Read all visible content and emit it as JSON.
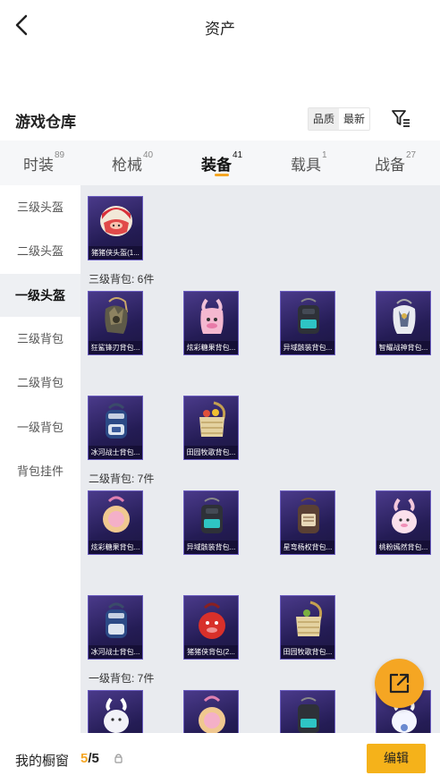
{
  "header": {
    "title": "资产"
  },
  "warehouse": {
    "title": "游戏仓库",
    "sort_quality": "品质",
    "sort_latest": "最新"
  },
  "tabs": [
    {
      "label": "时装",
      "count": "89"
    },
    {
      "label": "枪械",
      "count": "40"
    },
    {
      "label": "装备",
      "count": "41"
    },
    {
      "label": "载具",
      "count": "1"
    },
    {
      "label": "战备",
      "count": "27"
    }
  ],
  "active_tab": "装备",
  "sidebar": [
    {
      "label": "三级头盔"
    },
    {
      "label": "二级头盔"
    },
    {
      "label": "一级头盔"
    },
    {
      "label": "三级背包"
    },
    {
      "label": "二级背包"
    },
    {
      "label": "一级背包"
    },
    {
      "label": "背包挂件"
    }
  ],
  "selected_sidebar": "一级头盔",
  "helmet_items": [
    {
      "label": "猪猪侠头盔(1...",
      "icon": "helmet-icon"
    }
  ],
  "sections": [
    {
      "title": "三级背包: 6件",
      "items": [
        {
          "label": "狂鲨锋刃背包...",
          "icon": "backpack-icon"
        },
        {
          "label": "炫彩糖果背包...",
          "icon": "backpack-icon"
        },
        {
          "label": "异域骸装背包...",
          "icon": "backpack-icon"
        },
        {
          "label": "智耀战神背包...",
          "icon": "backpack-icon"
        },
        {
          "label": "冰河战士背包...",
          "icon": "backpack-icon"
        },
        {
          "label": "田园牧歌背包...",
          "icon": "backpack-icon"
        }
      ]
    },
    {
      "title": "二级背包: 7件",
      "items": [
        {
          "label": "炫彩糖果背包...",
          "icon": "backpack-icon"
        },
        {
          "label": "异域骸装背包...",
          "icon": "backpack-icon"
        },
        {
          "label": "星弯杨权背包...",
          "icon": "backpack-icon"
        },
        {
          "label": "桃粉嫣然背包...",
          "icon": "backpack-icon"
        },
        {
          "label": "冰河战士背包...",
          "icon": "backpack-icon"
        },
        {
          "label": "猪猪侠背包(2...",
          "icon": "backpack-icon"
        },
        {
          "label": "田园牧歌背包...",
          "icon": "backpack-icon"
        }
      ]
    },
    {
      "title": "一级背包: 7件",
      "items": [
        {
          "label": "",
          "icon": "backpack-icon"
        },
        {
          "label": "",
          "icon": "backpack-icon"
        },
        {
          "label": "",
          "icon": "backpack-icon"
        },
        {
          "label": "",
          "icon": "backpack-icon"
        }
      ]
    }
  ],
  "bottom": {
    "label": "我的橱窗",
    "count_current": "5",
    "count_total": "/5",
    "edit_label": "编辑"
  },
  "colors": {
    "accent": "#f5a623",
    "card_bg": "#2c2266"
  }
}
